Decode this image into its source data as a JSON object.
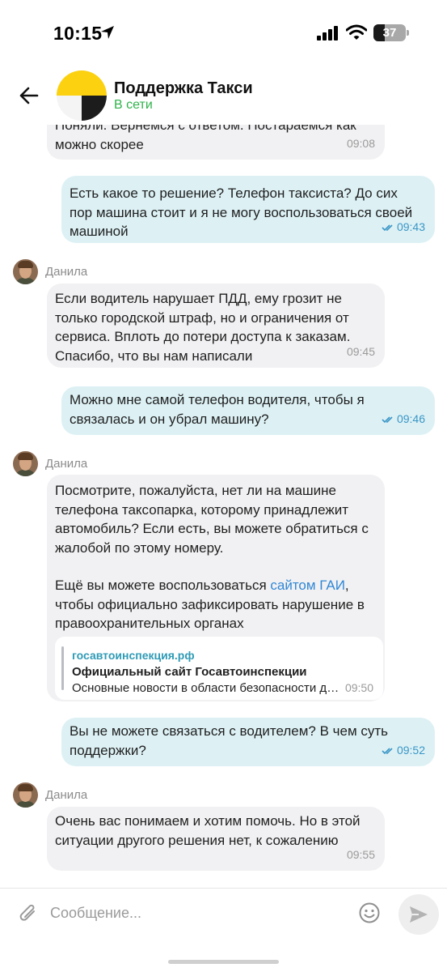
{
  "status_bar": {
    "time": "10:15",
    "battery": "37",
    "icons": [
      "location-arrow-icon",
      "signal-icon",
      "wifi-icon",
      "battery-icon"
    ]
  },
  "header": {
    "title": "Поддержка Такси",
    "status": "В сети",
    "back_icon": "arrow-left-icon"
  },
  "messages": [
    {
      "direction": "in",
      "text": "Поняли. Вернемся с ответом. Постараемся как\nможно скорее",
      "time": "09:08"
    },
    {
      "direction": "out",
      "text": "Есть какое то решение? Телефон таксиста? До сих\nпор машина стоит и я не могу воспользоваться своей\nмашиной",
      "time": "09:43",
      "read": true
    },
    {
      "direction": "in",
      "sender": "Данила",
      "text": "Если водитель нарушает ПДД, ему грозит не\nтолько городской штраф, но и ограничения от\nсервиса. Вплоть до потери доступа к заказам.\nСпасибо, что вы нам написали",
      "time": "09:45"
    },
    {
      "direction": "out",
      "text": "Можно мне самой телефон водителя, чтобы я\nсвязалась и он убрал машину?",
      "time": "09:46",
      "read": true
    },
    {
      "direction": "in",
      "sender": "Данила",
      "text": "Посмотрите, пожалуйста, нет ли на машине\nтелефона таксопарка, которому принадлежит\nавтомобиль? Если есть, вы можете обратиться с\nжалобой по этому номеру.",
      "text2_before": "Ещё вы можете воспользоваться ",
      "text2_link": "сайтом ГАИ",
      "text2_after": ",\nчтобы официально зафиксировать нарушение в\nправоохранительных органах",
      "link_preview": {
        "domain": "госавтоинспекция.рф",
        "title": "Официальный сайт Госавтоинспекции",
        "description": "Основные новости в области безопасности дорожного движения"
      },
      "time": "09:50"
    },
    {
      "direction": "out",
      "text": "Вы не можете связаться с водителем? В чем суть\nподдержки?",
      "time": "09:52",
      "read": true
    },
    {
      "direction": "in",
      "sender": "Данила",
      "text": "Очень вас понимаем и хотим помочь. Но в этой\nситуации другого решения нет, к сожалению",
      "time": "09:55"
    }
  ],
  "composer": {
    "placeholder": "Сообщение...",
    "attach_icon": "paperclip-icon",
    "emoji_icon": "smile-icon",
    "send_icon": "send-icon"
  },
  "colors": {
    "incoming_bubble": "#f1f1f3",
    "outgoing_bubble": "#ddf1f5",
    "online": "#2fb34a",
    "link": "#2f87d6",
    "read_ticks": "#3a96c6",
    "logo_yellow": "#fcd110"
  }
}
